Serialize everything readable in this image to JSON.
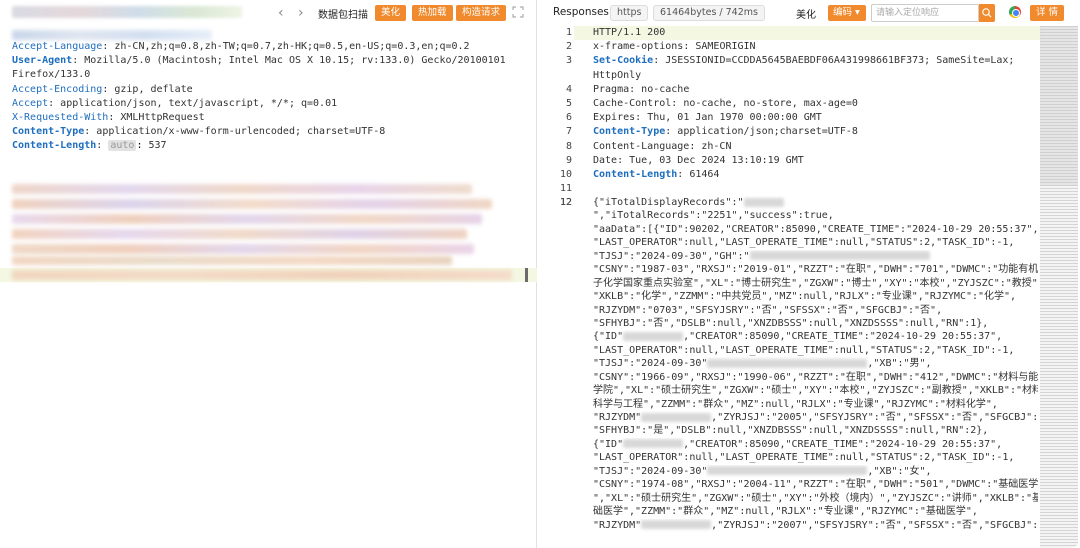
{
  "request": {
    "toolbar": {
      "tab_label": "数据包扫描",
      "buttons": [
        "美化",
        "热加载",
        "构造请求"
      ]
    },
    "headers": [
      {
        "key": "Accept-Language",
        "value": "zh-CN,zh;q=0.8,zh-TW;q=0.7,zh-HK;q=0.5,en-US;q=0.3,en;q=0.2",
        "style": "blue"
      },
      {
        "key": "User-Agent",
        "value": "Mozilla/5.0 (Macintosh; Intel Mac OS X 10.15; rv:133.0) Gecko/20100101",
        "style": "bold"
      },
      {
        "key": "",
        "value": "Firefox/133.0",
        "style": "plain"
      },
      {
        "key": "Accept-Encoding",
        "value": "gzip, deflate",
        "style": "blue"
      },
      {
        "key": "Accept",
        "value": "application/json, text/javascript, */*; q=0.01",
        "style": "blue"
      },
      {
        "key": "X-Requested-With",
        "value": "XMLHttpRequest",
        "style": "blue"
      },
      {
        "key": "Content-Type",
        "value": "application/x-www-form-urlencoded; charset=UTF-8",
        "style": "bold"
      },
      {
        "key": "Content-Length",
        "value": "537",
        "style": "bold",
        "tag": "auto"
      }
    ]
  },
  "response": {
    "toolbar": {
      "title": "Responses",
      "protocol": "https",
      "size_time": "61464bytes / 742ms",
      "beautify": "美化",
      "encoding": "编码",
      "search_placeholder": "请输入定位响应",
      "details": "详 情"
    },
    "line_numbers": [
      "1",
      "2",
      "3",
      "",
      "4",
      "5",
      "6",
      "7",
      "8",
      "9",
      "10",
      "11",
      "12"
    ],
    "header_lines": [
      {
        "key": "",
        "value": "HTTP/1.1 200",
        "style": "plain"
      },
      {
        "key": "x-frame-options",
        "value": "SAMEORIGIN",
        "style": "plain"
      },
      {
        "key": "Set-Cookie",
        "value": "JSESSIONID=CCDDA5645BAEBDF06A431998661BF373; SameSite=Lax;",
        "style": "bold"
      },
      {
        "key": "",
        "value": "HttpOnly",
        "style": "plain"
      },
      {
        "key": "Pragma",
        "value": "no-cache",
        "style": "plain"
      },
      {
        "key": "Cache-Control",
        "value": "no-cache, no-store, max-age=0",
        "style": "plain"
      },
      {
        "key": "Expires",
        "value": "Thu, 01 Jan 1970 00:00:00 GMT",
        "style": "plain"
      },
      {
        "key": "Content-Type",
        "value": "application/json;charset=UTF-8",
        "style": "bold"
      },
      {
        "key": "Content-Language",
        "value": "zh-CN",
        "style": "plain"
      },
      {
        "key": "Date",
        "value": "Tue, 03 Dec 2024 13:10:19 GMT",
        "style": "plain"
      },
      {
        "key": "Content-Length",
        "value": "61464",
        "style": "bold"
      },
      {
        "key": "",
        "value": "",
        "style": "plain"
      }
    ],
    "json_lines": [
      "{\"iTotalDisplayRecords\":\"",
      "\",\"iTotalRecords\":\"2251\",\"success\":true,",
      "\"aaData\":[{\"ID\":90202,\"CREATOR\":85090,\"CREATE_TIME\":\"2024-10-29 20:55:37\",",
      "\"LAST_OPERATOR\":null,\"LAST_OPERATE_TIME\":null,\"STATUS\":2,\"TASK_ID\":-1,",
      "\"TJSJ\":\"2024-09-30\",\"GH\":\"",
      "\"CSNY\":\"1987-03\",\"RXSJ\":\"2019-01\",\"RZZT\":\"在职\",\"DWH\":\"701\",\"DWMC\":\"功能有机分",
      "子化学国家重点实验室\",\"XL\":\"博士研究生\",\"ZGXW\":\"博士\",\"XY\":\"本校\",\"ZYJSZC\":\"教授\",",
      "\"XKLB\":\"化学\",\"ZZMM\":\"中共党员\",\"MZ\":null,\"RJLX\":\"专业课\",\"RJZYMC\":\"化学\",",
      "\"RJZYDM\":\"0703\",\"SFSYJSRY\":\"否\",\"SFSSX\":\"否\",\"SFGCBJ\":\"否\",",
      "\"SFHYBJ\":\"否\",\"DSLB\":null,\"XNZDBSSS\":null,\"XNZDSSSS\":null,\"RN\":1},",
      "{\"ID\"",
      "\"LAST_OPERATOR\":null,\"LAST_OPERATE_TIME\":null,\"STATUS\":2,\"TASK_ID\":-1,",
      "\"TJSJ\":\"2024-09-30\"",
      "\"CSNY\":\"1966-09\",\"RXSJ\":\"1990-06\",\"RZZT\":\"在职\",\"DWH\":\"412\",\"DWMC\":\"材料与能源",
      "学院\",\"XL\":\"硕士研究生\",\"ZGXW\":\"硕士\",\"XY\":\"本校\",\"ZYJSZC\":\"副教授\",\"XKLB\":\"材料",
      "科学与工程\",\"ZZMM\":\"群众\",\"MZ\":null,\"RJLX\":\"专业课\",\"RJZYMC\":\"材料化学\",",
      "\"RJZYDM\"",
      "\"SFHYBJ\":\"是\",\"DSLB\":null,\"XNZDBSSS\":null,\"XNZDSSSS\":null,\"RN\":2},",
      "{\"ID\"",
      "\"LAST_OPERATOR\":null,\"LAST_OPERATE_TIME\":null,\"STATUS\":2,\"TASK_ID\":-1,",
      "\"TJSJ\":\"2024-09-30\"",
      "\"CSNY\":\"1974-08\",\"RXSJ\":\"2004-11\",\"RZZT\":\"在职\",\"DWH\":\"501\",\"DWMC\":\"基础医学院",
      "\",\"XL\":\"硕士研究生\",\"ZGXW\":\"硕士\",\"XY\":\"外校（境内）\",\"ZYJSZC\":\"讲师\",\"XKLB\":\"基",
      "础医学\",\"ZZMM\":\"群众\",\"MZ\":null,\"RJLX\":\"专业课\",\"RJZYMC\":\"基础医学\",",
      "\"RJZYDM\""
    ],
    "json_line_numbers": [
      "12"
    ],
    "json_fragments": {
      "l3_tail": ",\"CREATOR\":85090,\"CREATE_TIME\":\"2024-10-29 20:55:37\",",
      "l5_tail": ",\"XB\":\"男\",",
      "l4_tail": ",\"ZYRJSJ\":\"2005\",\"SFSYJSRY\":\"否\",\"SFSSX\":\"否\",\"SFGCBJ\":\"是\",",
      "l6_tail": ",\"XB\":\"女\",",
      "l7_tail": ",\"ZYRJSJ\":\"2007\",\"SFSYJSRY\":\"否\",\"SFSSX\":\"否\",\"SFGCBJ\":\"否"
    }
  }
}
